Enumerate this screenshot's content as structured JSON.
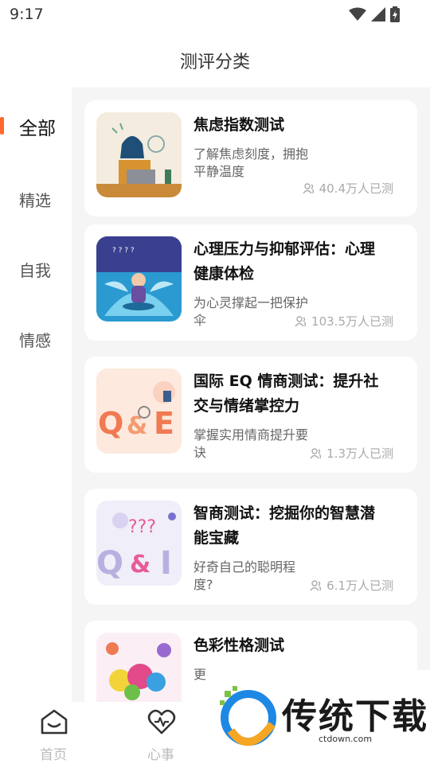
{
  "status": {
    "time": "9:17"
  },
  "header": {
    "title": "测评分类"
  },
  "sidebar": {
    "items": [
      {
        "label": "全部"
      },
      {
        "label": "精选"
      },
      {
        "label": "自我"
      },
      {
        "label": "情感"
      }
    ]
  },
  "tests": [
    {
      "title": "焦虑指数测试",
      "desc_line1": "了解焦虑刻度，拥抱",
      "desc_line2": "平静温度",
      "count": "40.4万人已测"
    },
    {
      "title_line1": "心理压力与抑郁评估：心理",
      "title_line2": "健康体检",
      "desc_line1": "为心灵撑起一把保护",
      "desc_line2": "伞",
      "count": "103.5万人已测"
    },
    {
      "title_line1": "国际 EQ 情商测试：提升社",
      "title_line2": "交与情绪掌控力",
      "desc_line1": "掌握实用情商提升要",
      "desc_line2": "诀",
      "count": "1.3万人已测"
    },
    {
      "title_line1": "智商测试：挖掘你的智慧潜",
      "title_line2": "能宝藏",
      "desc_line1": "好奇自己的聪明程",
      "desc_line2": "度?",
      "count": "6.1万人已测"
    },
    {
      "title": "色彩性格测试",
      "desc_line1": "更"
    }
  ],
  "tabbar": {
    "items": [
      {
        "label": "首页"
      },
      {
        "label": "心事"
      }
    ]
  },
  "watermark": {
    "brand": "传统下载",
    "url": "ctdown.com"
  },
  "colors": {
    "accent": "#ff6a2c",
    "background": "#f5f5f5"
  }
}
